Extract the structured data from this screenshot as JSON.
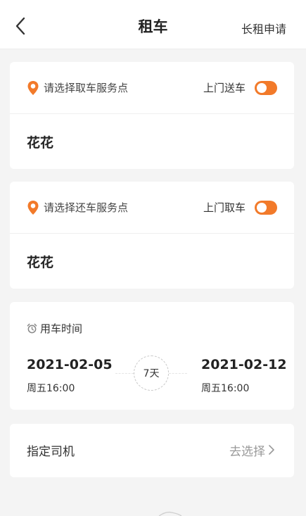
{
  "header": {
    "title": "租车",
    "right_link": "长租申请"
  },
  "pickup": {
    "label": "请选择取车服务点",
    "toggle_label": "上门送车",
    "toggle_on": true,
    "value": "花花"
  },
  "return": {
    "label": "请选择还车服务点",
    "toggle_label": "上门取车",
    "toggle_on": true,
    "value": "花花"
  },
  "time": {
    "label": "用车时间",
    "start_date": "2021-02-05",
    "start_day": "周五16:00",
    "duration": "7天",
    "end_date": "2021-02-12",
    "end_day": "周五16:00"
  },
  "driver": {
    "label": "指定司机",
    "action": "去选择"
  },
  "colors": {
    "accent": "#f27a2a",
    "background": "#f4f4f4"
  }
}
